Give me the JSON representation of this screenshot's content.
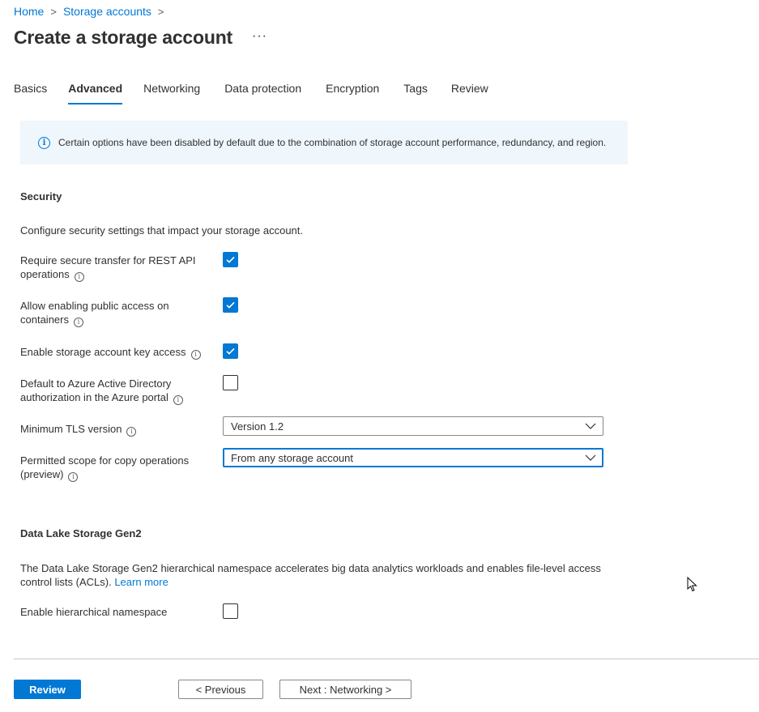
{
  "breadcrumb": {
    "home": "Home",
    "storage_accounts": "Storage accounts",
    "separator": ">"
  },
  "page": {
    "title": "Create a storage account",
    "more": "···"
  },
  "tabs": [
    "Basics",
    "Advanced",
    "Networking",
    "Data protection",
    "Encryption",
    "Tags",
    "Review"
  ],
  "active_tab": "Advanced",
  "info": {
    "text": "Certain options have been disabled by default due to the combination of storage account performance, redundancy, and region."
  },
  "security": {
    "title": "Security",
    "description": "Configure security settings that impact your storage account.",
    "secure_transfer": {
      "line1": "Require secure transfer for REST API",
      "line2": "operations",
      "checked": true
    },
    "public_access": {
      "line1": "Allow enabling public access on",
      "line2": "containers",
      "checked": true
    },
    "key_access": {
      "label": "Enable storage account key access",
      "checked": true
    },
    "aad_default": {
      "line1": "Default to Azure Active Directory",
      "line2": "authorization in the Azure portal",
      "checked": false
    },
    "tls": {
      "label": "Minimum TLS version",
      "value": "Version 1.2"
    },
    "copy_scope": {
      "line1": "Permitted scope for copy operations",
      "line2": "(preview)",
      "value": "From any storage account"
    }
  },
  "datalake": {
    "title": "Data Lake Storage Gen2",
    "description_line1": "The Data Lake Storage Gen2 hierarchical namespace accelerates big data analytics workloads and enables file-level access",
    "description_line2": "control lists (ACLs).",
    "learn_more": "Learn more",
    "hierarchical_namespace": {
      "label": "Enable hierarchical namespace",
      "checked": false
    }
  },
  "footer": {
    "review": "Review",
    "previous": "< Previous",
    "next": "Next : Networking >"
  },
  "colors": {
    "accent": "#0078d4",
    "text": "#323130",
    "info_bg": "#eff6fc"
  }
}
